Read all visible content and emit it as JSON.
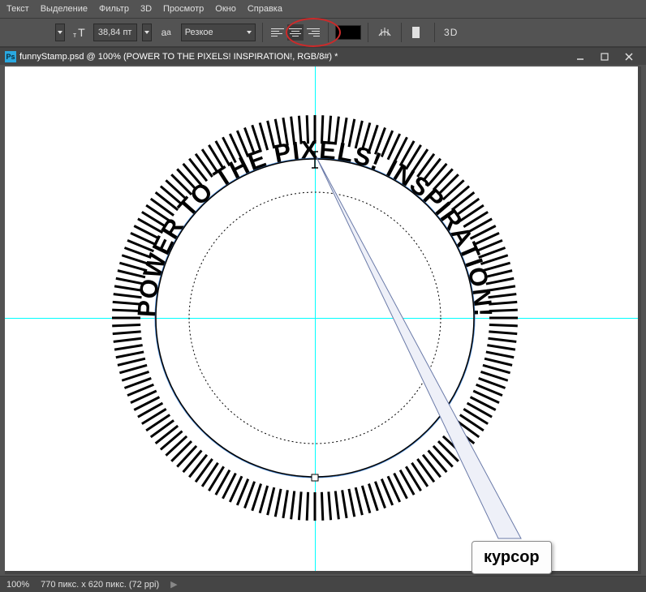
{
  "menu": {
    "items": [
      "Текст",
      "Выделение",
      "Фильтр",
      "3D",
      "Просмотр",
      "Окно",
      "Справка"
    ]
  },
  "options": {
    "font_size": "38,84 пт",
    "aa_label": "Резкое",
    "threeD": "3D"
  },
  "document": {
    "ps_badge": "Ps",
    "title": "funnyStamp.psd @ 100% (POWER TO THE PIXELS! INSPIRATION!, RGB/8#) *"
  },
  "canvas": {
    "circ_text": "POWER TO THE PIXELS! INSPIRATION!"
  },
  "callout": {
    "label": "курсор"
  },
  "status": {
    "zoom": "100%",
    "docinfo": "770 пикс. x 620 пикс. (72 ppi)"
  }
}
